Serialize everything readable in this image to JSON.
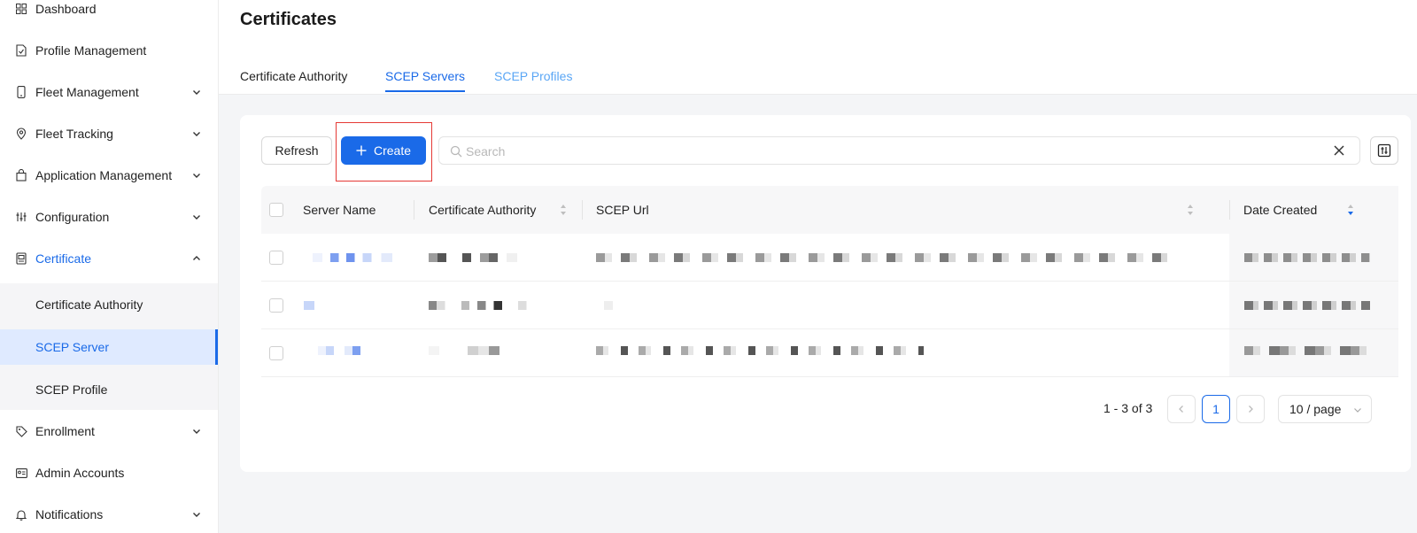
{
  "sidebar": {
    "items": [
      {
        "label": "Dashboard",
        "icon": "dashboard-icon",
        "chevron": false
      },
      {
        "label": "Profile Management",
        "icon": "document-check-icon",
        "chevron": false
      },
      {
        "label": "Fleet Management",
        "icon": "phone-icon",
        "chevron": true
      },
      {
        "label": "Fleet Tracking",
        "icon": "location-pin-icon",
        "chevron": true
      },
      {
        "label": "Application Management",
        "icon": "shopping-bag-icon",
        "chevron": true
      },
      {
        "label": "Configuration",
        "icon": "sliders-icon",
        "chevron": true
      },
      {
        "label": "Certificate",
        "icon": "certificate-icon",
        "chevron": "up",
        "active": true
      },
      {
        "label": "Enrollment",
        "icon": "tag-icon",
        "chevron": true
      },
      {
        "label": "Admin Accounts",
        "icon": "id-card-icon",
        "chevron": false
      },
      {
        "label": "Notifications",
        "icon": "bell-icon",
        "chevron": true
      }
    ],
    "sub_items": [
      {
        "label": "Certificate Authority"
      },
      {
        "label": "SCEP Server",
        "selected": true
      },
      {
        "label": "SCEP Profile"
      }
    ]
  },
  "header": {
    "title": "Certificates",
    "tabs": [
      {
        "label": "Certificate Authority"
      },
      {
        "label": "SCEP Servers",
        "active": true
      },
      {
        "label": "SCEP Profiles"
      }
    ]
  },
  "toolbar": {
    "refresh_label": "Refresh",
    "create_label": "Create",
    "search_placeholder": "Search"
  },
  "table": {
    "columns": [
      "Server Name",
      "Certificate Authority",
      "SCEP Url",
      "Date Created"
    ],
    "rows": [
      {
        "server_name": "",
        "certificate_authority": "",
        "scep_url": "",
        "date_created": ""
      },
      {
        "server_name": "",
        "certificate_authority": "",
        "scep_url": "",
        "date_created": ""
      },
      {
        "server_name": "",
        "certificate_authority": "",
        "scep_url": "",
        "date_created": ""
      }
    ]
  },
  "pagination": {
    "summary": "1 - 3 of 3",
    "current_page": "1",
    "page_size": "10 / page"
  },
  "colors": {
    "accent": "#1a6ae8",
    "tab_inactive_link": "#5aa6f5",
    "highlight": "#e53935"
  }
}
